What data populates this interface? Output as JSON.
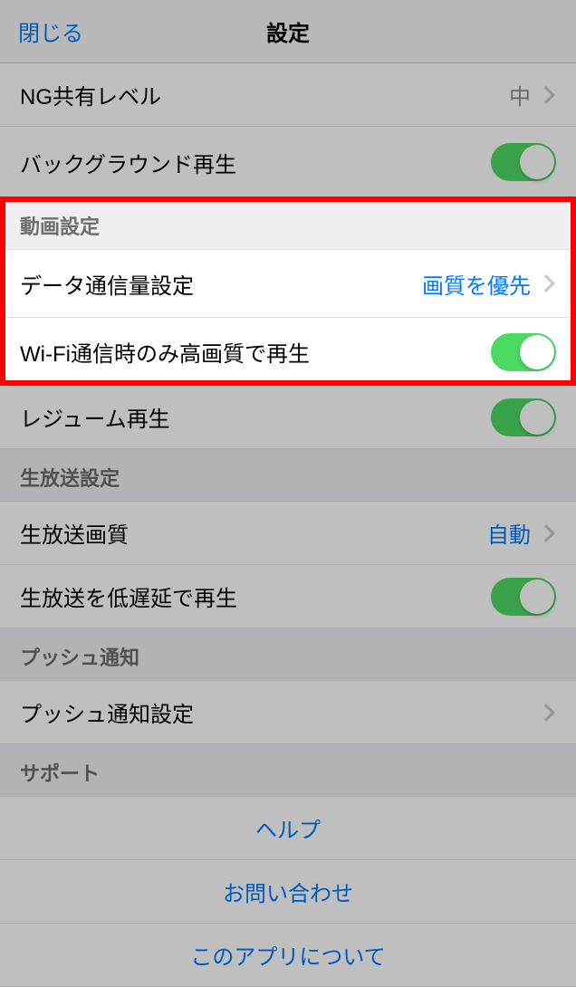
{
  "header": {
    "close": "閉じる",
    "title": "設定"
  },
  "ng_share": {
    "label": "NG共有レベル",
    "value": "中"
  },
  "background_play": {
    "label": "バックグラウンド再生",
    "on": true
  },
  "video_section": {
    "title": "動画設定"
  },
  "data_usage": {
    "label": "データ通信量設定",
    "value": "画質を優先"
  },
  "wifi_hq": {
    "label": "Wi-Fi通信時のみ高画質で再生",
    "on": true
  },
  "resume": {
    "label": "レジューム再生",
    "on": true
  },
  "live_section": {
    "title": "生放送設定"
  },
  "live_quality": {
    "label": "生放送画質",
    "value": "自動"
  },
  "live_low_latency": {
    "label": "生放送を低遅延で再生",
    "on": true
  },
  "push_section": {
    "title": "プッシュ通知"
  },
  "push_settings": {
    "label": "プッシュ通知設定"
  },
  "support_section": {
    "title": "サポート"
  },
  "support": {
    "help": "ヘルプ",
    "contact": "お問い合わせ",
    "about": "このアプリについて"
  }
}
